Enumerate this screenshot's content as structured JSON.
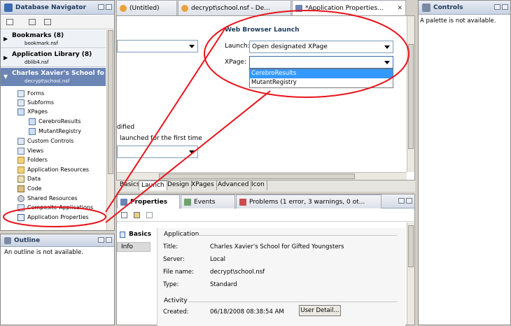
{
  "navigator": {
    "title": "Database Navigator",
    "items": [
      {
        "label": "Bookmarks (8)",
        "sub": "bookmark.nsf"
      },
      {
        "label": "Application Library (8)",
        "sub": "dblib4.nsf"
      },
      {
        "label": "Charles Xavier's School fo",
        "sub": "decrypt\\school.nsf"
      }
    ],
    "tree": [
      "Forms",
      "Subforms",
      "XPages",
      "CerebroResults",
      "MutantRegistry",
      "Custom Controls",
      "Views",
      "Folders",
      "Application Resources",
      "Data",
      "Code",
      "Shared Resources",
      "Composite Applications",
      "Application Properties"
    ]
  },
  "outline": {
    "title": "Outline",
    "message": "An outline is not available."
  },
  "editor": {
    "tabs": [
      "(Untitled)",
      "decrypt\\school.nsf - De...",
      "*Application Properties..."
    ],
    "section_title": "Web Browser Launch",
    "launch_label": "Launch:",
    "launch_value": "Open designated XPage",
    "xpage_label": "XPage:",
    "xpage_options": [
      "CerebroResults",
      "MutantRegistry"
    ],
    "left_text_1": "dified",
    "left_text_2": "launched for the first time",
    "bottom_tabs": [
      "Basics",
      "Launch",
      "Design",
      "XPages",
      "Advanced",
      "Icon"
    ]
  },
  "controls": {
    "title": "Controls",
    "message": "A palette is not available."
  },
  "props": {
    "tabs": [
      "Properties",
      "Events",
      "Problems (1 error, 3 warnings, 0 ot..."
    ],
    "side_title": "Basics",
    "side_item": "Info",
    "section_app": "Application",
    "rows": [
      {
        "k": "Title:",
        "v": "Charles Xavier's School for Gifted Youngsters"
      },
      {
        "k": "Server:",
        "v": "Local"
      },
      {
        "k": "File name:",
        "v": "decrypt\\school.nsf"
      },
      {
        "k": "Type:",
        "v": "Standard"
      }
    ],
    "section_activity": "Activity",
    "created_label": "Created:",
    "created_value": "06/18/2008 08:38:54 AM",
    "user_detail": "User Detail..."
  },
  "colors": {
    "highlight": "#3399ff",
    "callout": "#e8141b",
    "nav_selected": "#6b85b5"
  }
}
